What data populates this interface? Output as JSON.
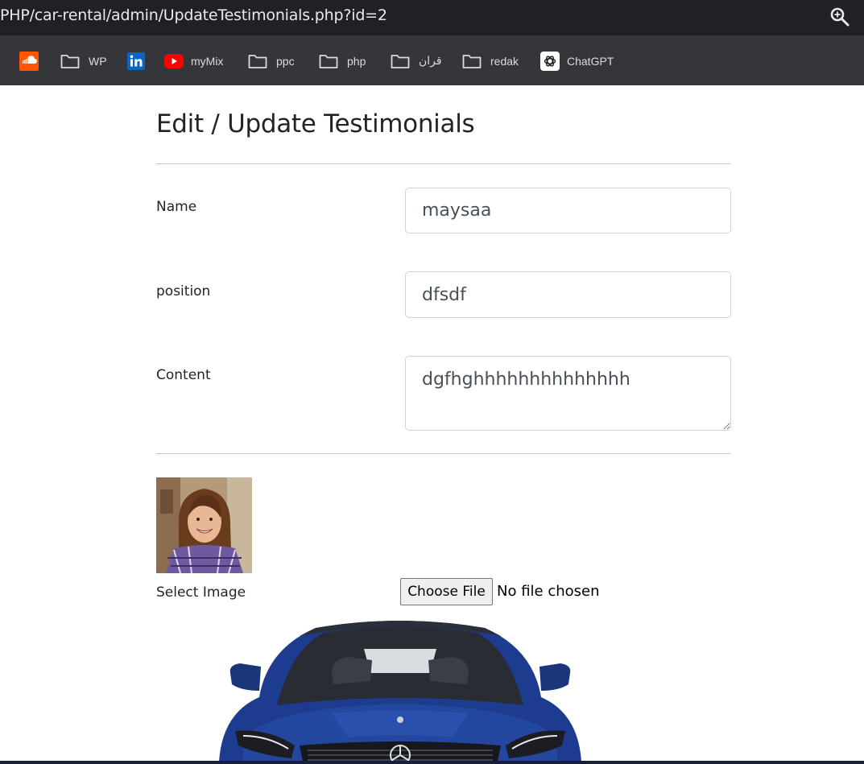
{
  "browser": {
    "url": "PHP/car-rental/admin/UpdateTestimonials.php?id=2",
    "bookmarks": [
      {
        "label": "",
        "icon": "soundcloud-icon"
      },
      {
        "label": "WP",
        "icon": "folder-icon"
      },
      {
        "label": "",
        "icon": "linkedin-icon"
      },
      {
        "label": "myMix",
        "icon": "youtube-icon"
      },
      {
        "label": "ppc",
        "icon": "folder-icon"
      },
      {
        "label": "php",
        "icon": "folder-icon"
      },
      {
        "label": "قران",
        "icon": "folder-icon"
      },
      {
        "label": "redak",
        "icon": "folder-icon"
      },
      {
        "label": "ChatGPT",
        "icon": "chatgpt-icon"
      }
    ]
  },
  "form": {
    "title": "Edit / Update Testimonials",
    "name_label": "Name",
    "name_value": "maysaa",
    "position_label": "position",
    "position_value": "dfsdf",
    "content_label": "Content",
    "content_value": "dgfhghhhhhhhhhhhhhh",
    "image_label": "Select Image",
    "choose_file_label": "Choose File",
    "file_status": "No file chosen"
  },
  "colors": {
    "urlbar_bg": "#202124",
    "bookmarks_bg": "#35363a",
    "text": "#212529"
  }
}
